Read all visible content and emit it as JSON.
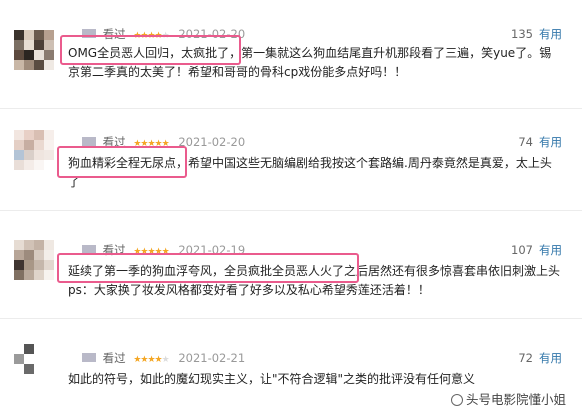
{
  "reviews": [
    {
      "seen": "看过",
      "stars": 4,
      "date": "2021-02-20",
      "votes": "135",
      "useful": "有用",
      "line1": "OMG全员恶人回归，太疯批了，第一集就这么狗血结尾直升机那段看了三遍，笑yue了。锡",
      "line2": "京第二季真的太美了！希望和哥哥的骨科cp戏份能多点好吗！！"
    },
    {
      "seen": "看过",
      "stars": 5,
      "date": "2021-02-20",
      "votes": "74",
      "useful": "有用",
      "line1": "狗血精彩全程无尿点，希望中国这些无脑编剧给我按这个套路编.周丹泰竟然是真爱，太上头",
      "line2": "了"
    },
    {
      "seen": "看过",
      "stars": 5,
      "date": "2021-02-19",
      "votes": "107",
      "useful": "有用",
      "line1": "延续了第一季的狗血浮夸风，全员疯批全员恶人火了之后居然还有很多惊喜套串依旧刺激上头",
      "line2": "ps：大家换了妆发风格都变好看了好多以及私心希望秀莲还活着！！"
    },
    {
      "seen": "看过",
      "stars": 4,
      "date": "2021-02-21",
      "votes": "72",
      "useful": "有用",
      "line1": "如此的符号，如此的魔幻现实主义，让\"不符合逻辑\"之类的批评没有任何意义"
    }
  ],
  "watermark": "头号电影院懂小姐",
  "colors": {
    "highlight": "#ea5b8d",
    "star": "#f4a623",
    "link": "#3377aa"
  }
}
